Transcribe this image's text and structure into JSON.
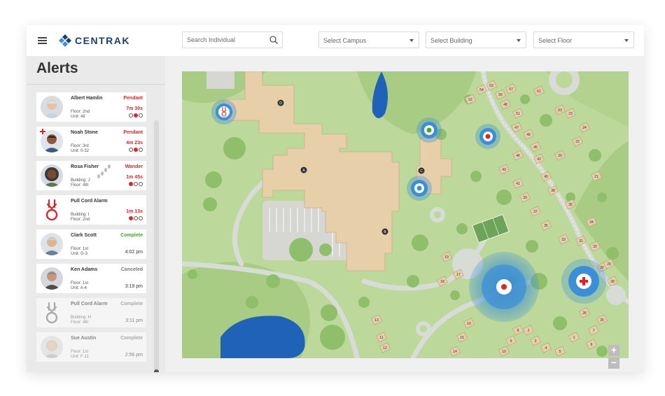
{
  "app": {
    "logo_text": "CENTRAK"
  },
  "toolbar": {
    "search_placeholder": "Search Individual",
    "campus": "Select Campus",
    "building": "Select Building",
    "floor": "Select Floor"
  },
  "sidebar": {
    "title": "Alerts",
    "alerts": [
      {
        "name": "Albert Hamlin",
        "line1": "Floor: 2nd",
        "line2": "Unit: 48",
        "status": "Pendant",
        "time": "7m 30s"
      },
      {
        "name": "Noah Stone",
        "line1": "Floor: 3rd",
        "line2": "Unit: 0-32",
        "status": "Pendant",
        "time": "4m 23s"
      },
      {
        "name": "Rosa Fisher",
        "line1": "Building: J",
        "line2": "Floor: 4th",
        "status": "Wander",
        "time": "1m 45s"
      },
      {
        "name": "Pull Cord Alarm",
        "line1": "Building: I",
        "line2": "Floor: 2nd",
        "status": "",
        "time": "1m 13s"
      },
      {
        "name": "Clark Scott",
        "line1": "Floor: 1st",
        "line2": "Unit: G-3",
        "status": "Complete",
        "time": "4:02 pm"
      },
      {
        "name": "Ken Adams",
        "line1": "Floor: 1st",
        "line2": "Unit: A-4",
        "status": "Canceled",
        "time": "3:19 pm"
      },
      {
        "name": "Pull Cord Alarm",
        "line1": "Building: H",
        "line2": "Floor: 4th",
        "status": "Complete",
        "time": "3:11 pm"
      },
      {
        "name": "Sue Austin",
        "line1": "Floor: 1st",
        "line2": "Unit: F-11",
        "status": "Complete",
        "time": "2:56 pm"
      }
    ]
  },
  "map": {
    "buildings": [
      "A",
      "B",
      "C",
      "D"
    ],
    "lot_numbers": [
      "52",
      "54",
      "53",
      "56",
      "57",
      "48",
      "61",
      "63",
      "51",
      "47",
      "49",
      "45",
      "46",
      "43",
      "42",
      "41",
      "40",
      "39",
      "38",
      "37",
      "36",
      "35",
      "34",
      "33",
      "31",
      "32",
      "30",
      "29",
      "28",
      "19",
      "18",
      "17",
      "16",
      "15",
      "14",
      "13",
      "12",
      "11",
      "10",
      "9",
      "8",
      "7",
      "6",
      "5",
      "4",
      "3",
      "2",
      "1",
      "26",
      "25",
      "24",
      "23",
      "22",
      "21",
      "20"
    ],
    "zoom_in": "+",
    "zoom_out": "−"
  },
  "colors": {
    "alert_red": "#d9262c",
    "complete_green": "#4aa42a",
    "marker_blue": "#3a8fd6",
    "grass": "#bcd89a",
    "building": "#e6cfa9"
  }
}
